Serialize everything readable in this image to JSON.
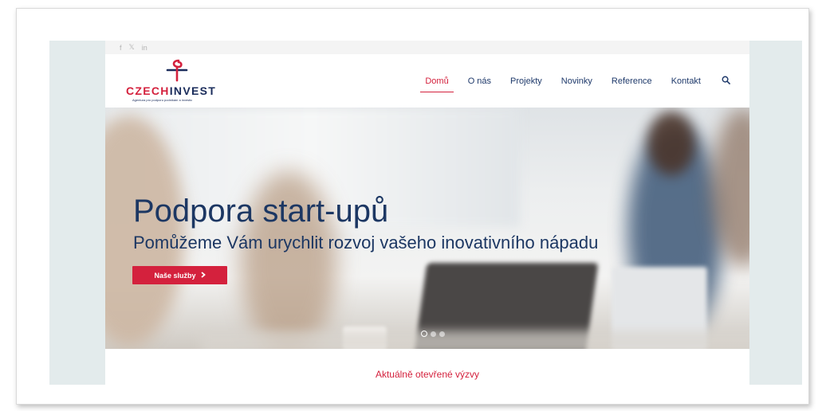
{
  "social": {
    "facebook": "f",
    "twitter": "𝕏",
    "linkedin": "in"
  },
  "logo": {
    "czech": "CZECH",
    "invest": "INVEST",
    "tagline": "Agentura pro podporu podnikání a investic",
    "brand_red": "#d4213d",
    "brand_blue": "#1a2c5b"
  },
  "nav": {
    "items": [
      {
        "label": "Domů",
        "active": true
      },
      {
        "label": "O nás",
        "active": false
      },
      {
        "label": "Projekty",
        "active": false
      },
      {
        "label": "Novinky",
        "active": false
      },
      {
        "label": "Reference",
        "active": false
      },
      {
        "label": "Kontakt",
        "active": false
      }
    ],
    "search_icon": "search-icon"
  },
  "hero": {
    "title": "Podpora start-upů",
    "subtitle": "Pomůžeme Vám urychlit rozvoj vašeho inovativního nápadu",
    "button_label": "Naše služby",
    "slides": 3,
    "active_slide": 1
  },
  "section": {
    "title": "Aktuálně otevřené výzvy"
  }
}
